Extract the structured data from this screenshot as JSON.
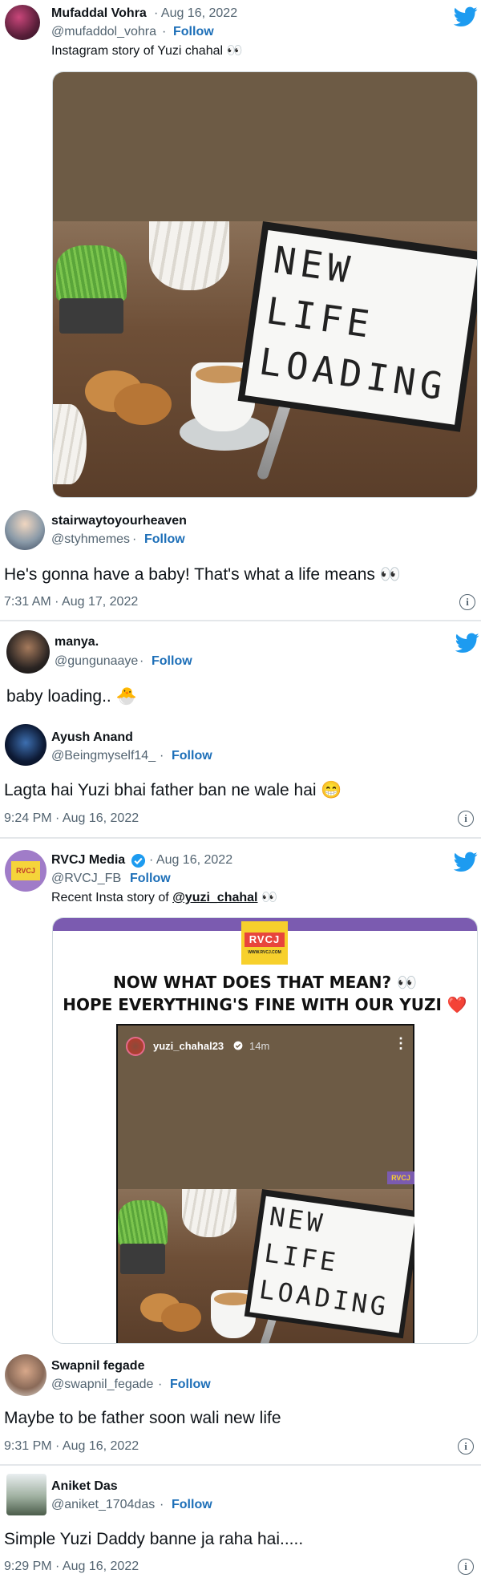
{
  "tweet1": {
    "name": "Mufaddal Vohra",
    "date": "Aug 16, 2022",
    "handle": "@mufaddol_vohra",
    "follow": "Follow",
    "text": "Instagram story of Yuzi chahal 👀",
    "image_text": [
      "NEW",
      "LIFE",
      "LOADING"
    ]
  },
  "reply1": {
    "name": "stairwaytoyourheaven",
    "handle": "@styhmemes",
    "follow": "Follow",
    "text": "He's gonna have a baby! That's what a life means 👀",
    "time": "7:31 AM · Aug 17, 2022"
  },
  "tweet2": {
    "name": "manya.",
    "handle": "@gungunaaye",
    "follow": "Follow",
    "text": "baby loading.. 🐣"
  },
  "reply2": {
    "name": "Ayush Anand",
    "handle": "@Beingmyself14_",
    "follow": "Follow",
    "text": "Lagta hai Yuzi bhai father ban ne wale hai 😁",
    "time": "9:24 PM · Aug 16, 2022"
  },
  "tweet3": {
    "name": "RVCJ Media",
    "date": "Aug 16, 2022",
    "handle": "@RVCJ_FB",
    "follow": "Follow",
    "text_prefix": "Recent Insta story of ",
    "mention": "@yuzi_chahal",
    "text_suffix": " 👀",
    "logo_text": "RVCJ",
    "logo_sub": "WWW.RVCJ.COM",
    "headline1": "NOW WHAT DOES THAT MEAN? 👀",
    "headline2": "HOPE EVERYTHING'S FINE WITH OUR YUZI ❤️",
    "story_user": "yuzi_chahal23",
    "story_time": "14m",
    "watermark": "RVCJ",
    "image_text": [
      "NEW",
      "LIFE",
      "LOADING"
    ]
  },
  "reply3": {
    "name": "Swapnil fegade",
    "handle": "@swapnil_fegade",
    "follow": "Follow",
    "text": "Maybe to be father soon wali new life",
    "time": "9:31 PM · Aug 16, 2022"
  },
  "reply4": {
    "name": "Aniket Das",
    "handle": "@aniket_1704das",
    "follow": "Follow",
    "text": "Simple Yuzi Daddy banne ja raha hai.....",
    "time": "9:29 PM · Aug 16, 2022"
  },
  "colors": {
    "follow": "#1d6fb8",
    "twitter_blue": "#1d9bf0",
    "muted": "#536471",
    "story_brown": "#6d5b45",
    "purple_band": "#7b5bb0"
  }
}
